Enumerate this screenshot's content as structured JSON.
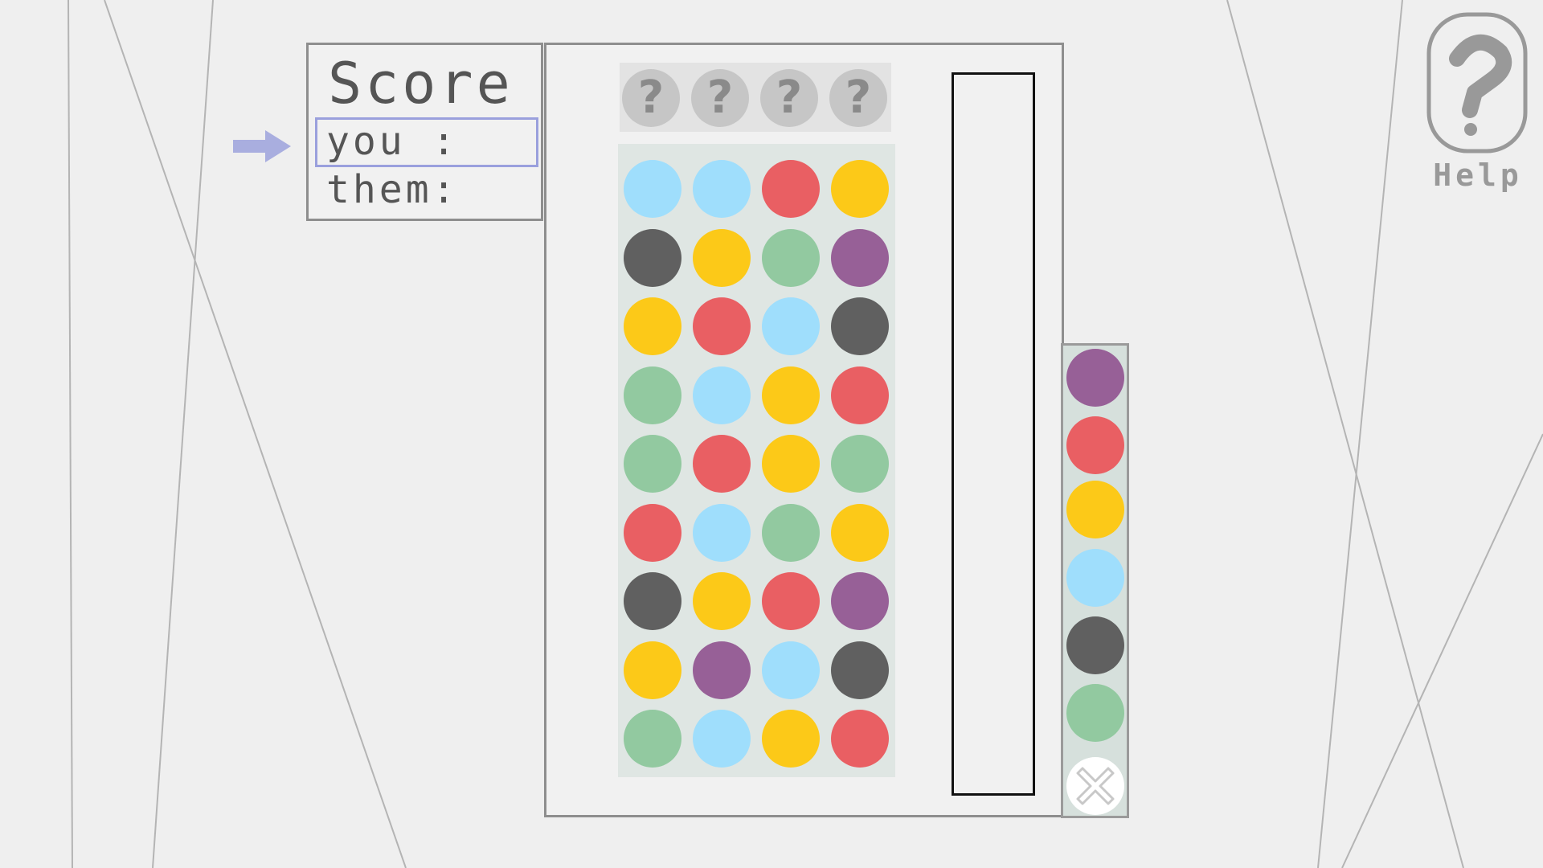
{
  "score": {
    "title": "Score",
    "you_label": "you :",
    "them_label": "them:"
  },
  "secret_code": {
    "slots": [
      "?",
      "?",
      "?",
      "?"
    ]
  },
  "guesses": [
    [
      "lightblue",
      "lightblue",
      "red",
      "yellow"
    ],
    [
      "darkgray",
      "yellow",
      "green",
      "purple"
    ],
    [
      "yellow",
      "red",
      "lightblue",
      "darkgray"
    ],
    [
      "green",
      "lightblue",
      "yellow",
      "red"
    ],
    [
      "green",
      "red",
      "yellow",
      "green"
    ],
    [
      "red",
      "lightblue",
      "green",
      "yellow"
    ],
    [
      "darkgray",
      "yellow",
      "red",
      "purple"
    ],
    [
      "yellow",
      "purple",
      "lightblue",
      "darkgray"
    ],
    [
      "green",
      "lightblue",
      "yellow",
      "red"
    ]
  ],
  "palette": [
    "purple",
    "red",
    "yellow",
    "lightblue",
    "darkgray",
    "green"
  ],
  "colors": {
    "lightblue": "#9fdefc",
    "red": "#e95f63",
    "yellow": "#fcc918",
    "darkgray": "#606060",
    "green": "#92c9a0",
    "purple": "#976097",
    "accent_arrow": "#a9aedf"
  },
  "help": {
    "label": "Help",
    "icon": "question-mark-icon"
  },
  "clear_icon": "close-icon"
}
